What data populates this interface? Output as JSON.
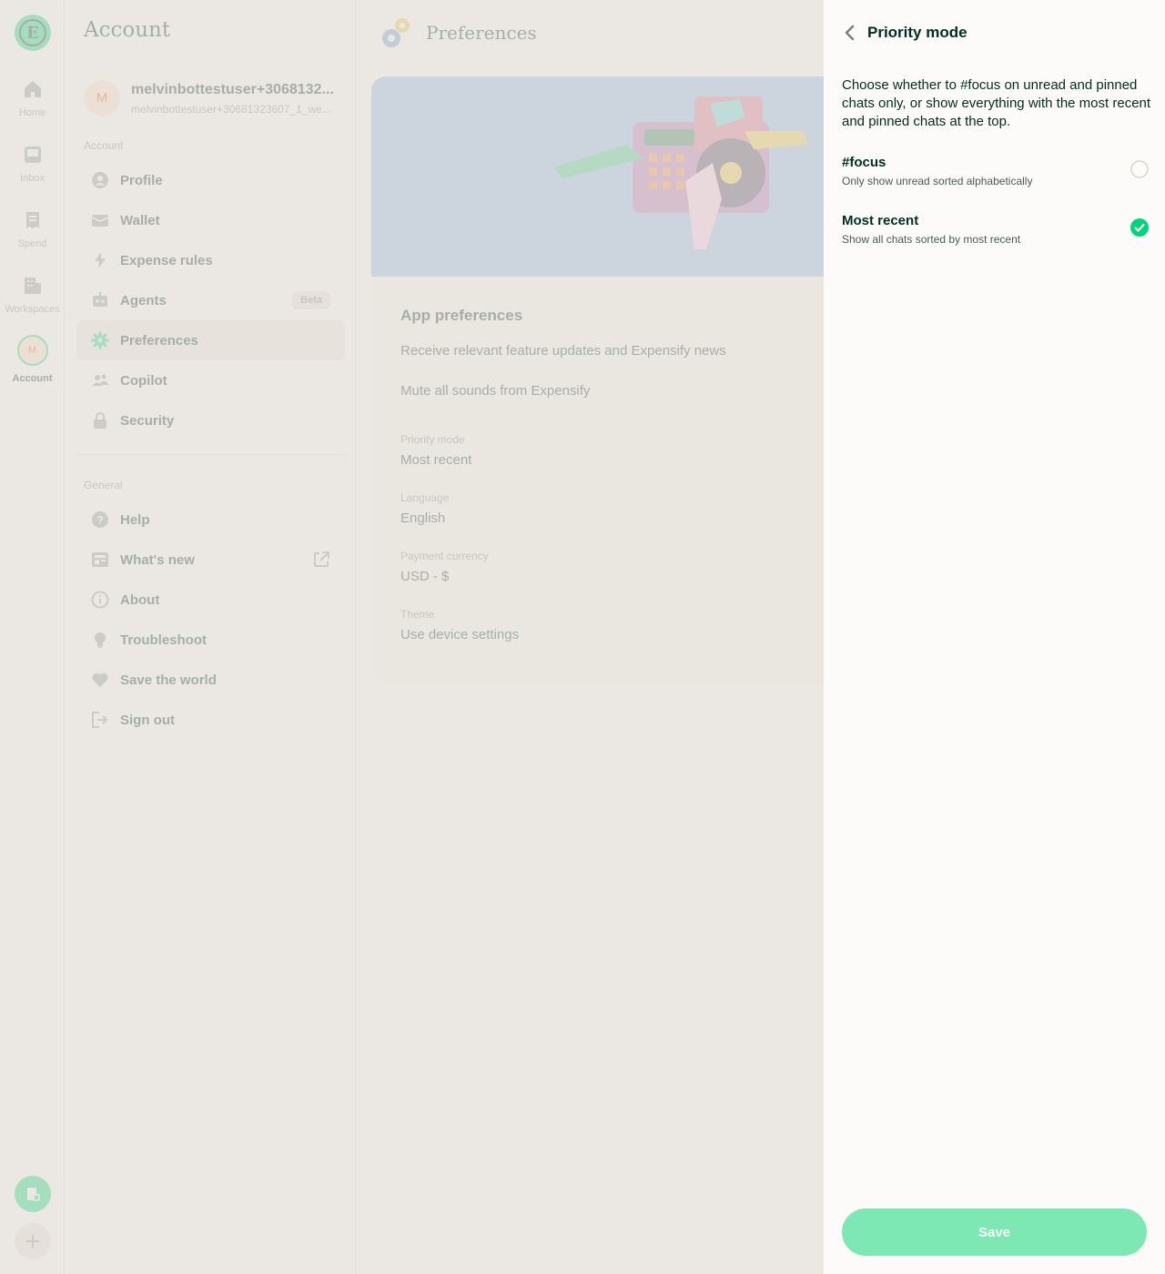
{
  "nav_rail": {
    "items": [
      {
        "label": "Home",
        "icon": "home-icon"
      },
      {
        "label": "Inbox",
        "icon": "inbox-icon"
      },
      {
        "label": "Spend",
        "icon": "receipt-icon"
      },
      {
        "label": "Workspaces",
        "icon": "building-icon"
      },
      {
        "label": "Account",
        "icon": "avatar",
        "avatar_initial": "M"
      }
    ]
  },
  "sidebar": {
    "title": "Account",
    "user": {
      "avatar_initial": "M",
      "name": "melvinbottestuser+3068132...",
      "email": "melvinbottestuser+30681323607_1_we..."
    },
    "account_section_label": "Account",
    "account_items": [
      {
        "label": "Profile",
        "icon": "user-circle-icon"
      },
      {
        "label": "Wallet",
        "icon": "wallet-icon"
      },
      {
        "label": "Expense rules",
        "icon": "lightning-icon"
      },
      {
        "label": "Agents",
        "icon": "robot-icon",
        "badge": "Beta"
      },
      {
        "label": "Preferences",
        "icon": "gear-icon",
        "selected": true
      },
      {
        "label": "Copilot",
        "icon": "users-icon"
      },
      {
        "label": "Security",
        "icon": "lock-icon"
      }
    ],
    "general_section_label": "General",
    "general_items": [
      {
        "label": "Help",
        "icon": "question-icon"
      },
      {
        "label": "What's new",
        "icon": "newspaper-icon",
        "external": true
      },
      {
        "label": "About",
        "icon": "info-icon"
      },
      {
        "label": "Troubleshoot",
        "icon": "lightbulb-icon"
      },
      {
        "label": "Save the world",
        "icon": "heart-icon"
      },
      {
        "label": "Sign out",
        "icon": "sign-out-icon"
      }
    ]
  },
  "main": {
    "title": "Preferences",
    "card_title": "App preferences",
    "feature_updates_label": "Receive relevant feature updates and Expensify news",
    "mute_sounds_label": "Mute all sounds from Expensify",
    "fields": [
      {
        "label": "Priority mode",
        "value": "Most recent"
      },
      {
        "label": "Language",
        "value": "English"
      },
      {
        "label": "Payment currency",
        "value": "USD - $"
      },
      {
        "label": "Theme",
        "value": "Use device settings"
      }
    ]
  },
  "panel": {
    "title": "Priority mode",
    "description": "Choose whether to #focus on unread and pinned chats only, or show everything with the most recent and pinned chats at the top.",
    "options": [
      {
        "title": "#focus",
        "subtitle": "Only show unread sorted alphabetically",
        "selected": false
      },
      {
        "title": "Most recent",
        "subtitle": "Show all chats sorted by most recent",
        "selected": true
      }
    ],
    "save_label": "Save"
  },
  "colors": {
    "brand_green": "#03d47c",
    "text_dark": "#002e22",
    "text_muted": "#76847e",
    "save_disabled": "#7de8b4",
    "hero_blue": "#8bb5e6"
  }
}
